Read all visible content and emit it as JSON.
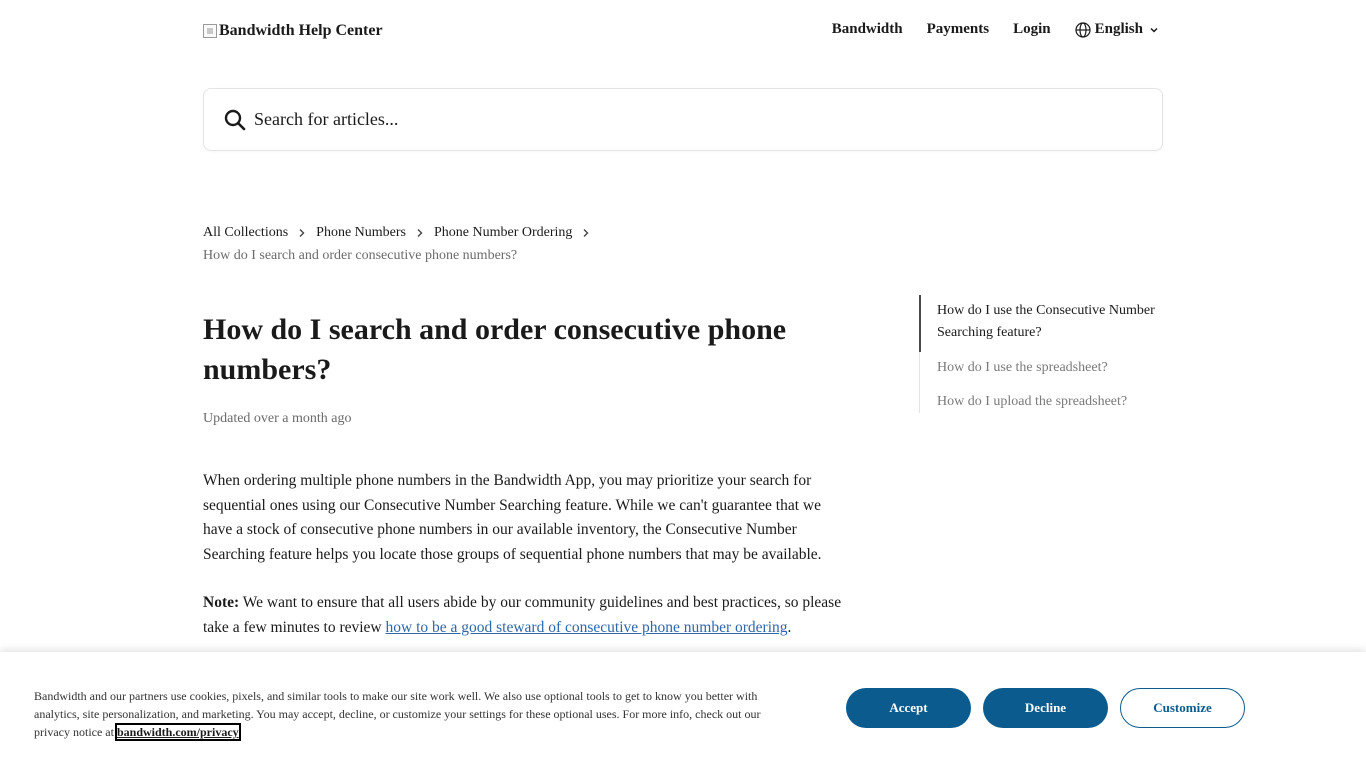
{
  "header": {
    "logo_text": "Bandwidth Help Center",
    "nav": [
      "Bandwidth",
      "Payments",
      "Login"
    ],
    "language": "English"
  },
  "search": {
    "placeholder": "Search for articles..."
  },
  "breadcrumb": {
    "items": [
      "All Collections",
      "Phone Numbers",
      "Phone Number Ordering"
    ],
    "current": "How do I search and order consecutive phone numbers?"
  },
  "article": {
    "title": "How do I search and order consecutive phone numbers?",
    "updated": "Updated over a month ago",
    "intro": "When ordering multiple phone numbers in the Bandwidth App, you may prioritize your search for sequential ones using our Consecutive Number Searching feature. While we can't guarantee that we have a stock of consecutive phone numbers in our available inventory, the Consecutive Number Searching feature helps you locate those groups of sequential phone numbers that may be available.",
    "note_label": "Note:",
    "note_text": " We want to ensure that all users abide by our community guidelines and best practices, so please take a few minutes to review ",
    "note_link": "how to be a good steward of consecutive phone number ordering",
    "note_end": "."
  },
  "toc": [
    "How do I use the Consecutive Number Searching feature?",
    "How do I use the spreadsheet?",
    "How do I upload the spreadsheet?"
  ],
  "cookie": {
    "text": "Bandwidth and our partners use cookies, pixels, and similar tools to make our site work well. We also use optional tools to get to know you better with analytics, site personalization, and marketing. You may accept, decline, or customize your settings for these optional uses. For more info, check out our privacy notice at ",
    "link": "bandwidth.com/privacy",
    "accept": "Accept",
    "decline": "Decline",
    "customize": "Customize"
  },
  "colors": {
    "primary_button": "#0b5b8f",
    "link": "#2e68a8"
  }
}
